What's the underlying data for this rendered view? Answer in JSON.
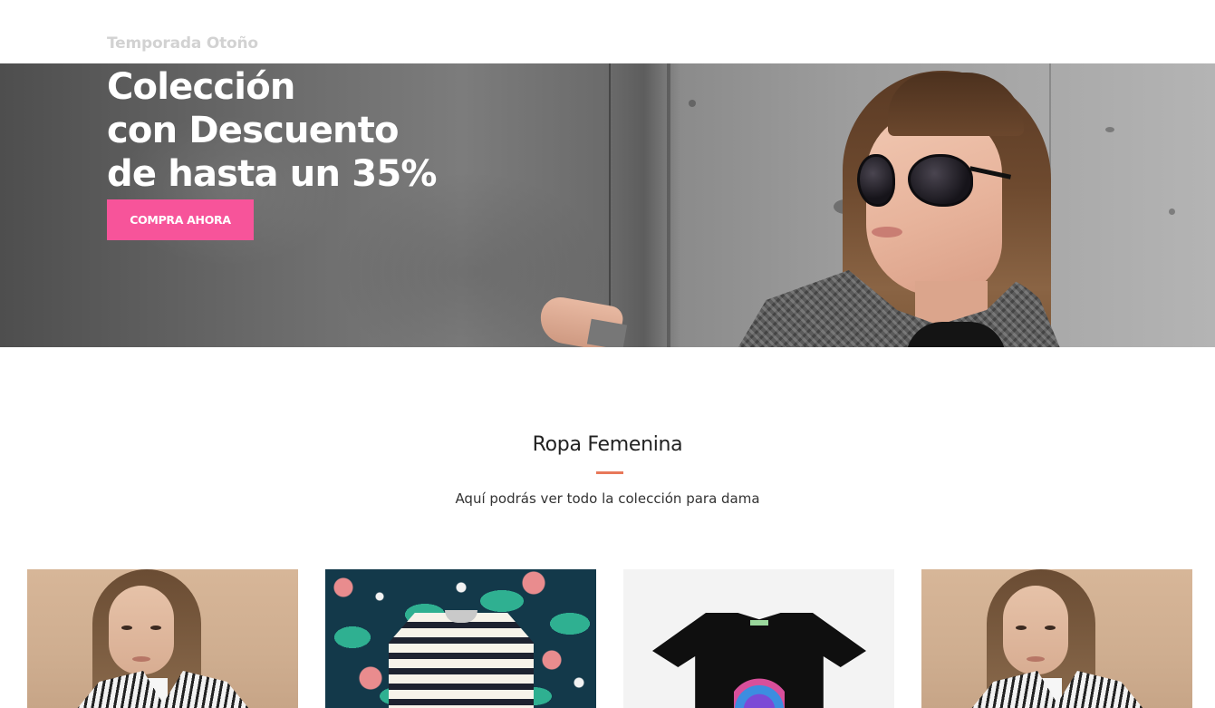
{
  "hero": {
    "season": "Temporada Otoño",
    "heading_lines": [
      "Colección",
      "con Descuento",
      "de hasta un 35%"
    ],
    "cta_label": "COMPRA AHORA",
    "cta_color": "#f7549a"
  },
  "section": {
    "title": "Ropa Femenina",
    "subtitle": "Aquí podrás ver todo la colección para dama",
    "divider_color": "#e8785a"
  },
  "products": [
    {
      "image": "woman-striped-blazer-photo"
    },
    {
      "image": "striped-sweater-floral-background-photo"
    },
    {
      "image": "black-graphic-tshirt-photo"
    },
    {
      "image": "woman-striped-blazer-photo"
    }
  ]
}
